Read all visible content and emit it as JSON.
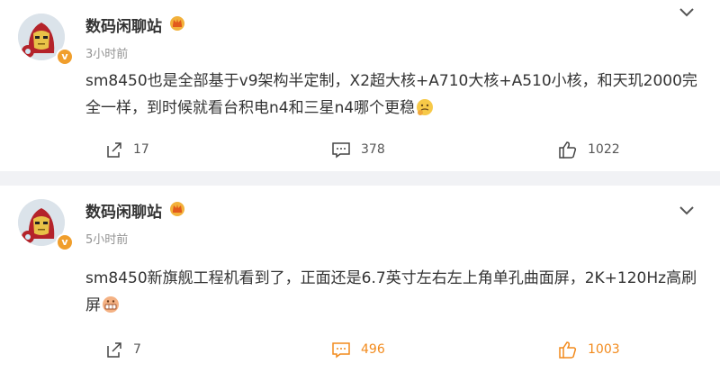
{
  "posts": [
    {
      "username": "数码闲聊站",
      "time": "3小时前",
      "content": "sm8450也是全部基于v9架构半定制，X2超大核+A710大核+A510小核，和天玑2000完全一样，到时候就看台积电n4和三星n4哪个更稳",
      "repost_count": "17",
      "comment_count": "378",
      "like_count": "1022"
    },
    {
      "username": "数码闲聊站",
      "time": "5小时前",
      "content": "sm8450新旗舰工程机看到了，正面还是6.7英寸左右左上角单孔曲面屏，2K+120Hz高刷屏",
      "repost_count": "7",
      "comment_count": "496",
      "like_count": "1003"
    }
  ],
  "colors": {
    "accent_orange": "#f28a1c",
    "verified_badge": "#f09e2c",
    "timestamp_gray": "#939393",
    "background": "#f1f2f5"
  },
  "icons": {
    "verified": "v-badge-icon",
    "member": "crown-icon",
    "menu": "chevron-down-icon",
    "repost": "share-icon",
    "comment": "comment-icon",
    "like": "thumbs-up-icon"
  },
  "badge_text": "v"
}
